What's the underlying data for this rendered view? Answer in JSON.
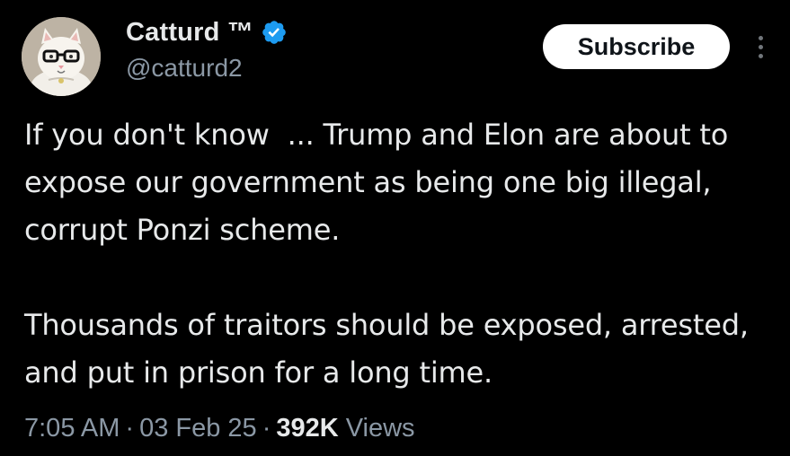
{
  "author": {
    "display_name": "Catturd ™",
    "handle": "@catturd2",
    "verified": true,
    "verified_color": "#1d9bf0"
  },
  "actions": {
    "subscribe_label": "Subscribe",
    "more_icon": "more-vertical-icon"
  },
  "tweet": {
    "paragraphs": [
      "If you don't know  ... Trump and Elon are about to expose our government as being one big illegal, corrupt Ponzi scheme.",
      "Thousands of traitors should be exposed, arrested, and put in prison for a long time."
    ]
  },
  "meta": {
    "time": "7:05 AM",
    "separator": "·",
    "date": "03 Feb 25",
    "views_count": "392K",
    "views_label": "Views"
  },
  "colors": {
    "background": "#000000",
    "primary_text": "#e7e9ea",
    "secondary_text": "#8b98a5",
    "button_bg": "#ffffff",
    "button_text": "#0f1419"
  }
}
